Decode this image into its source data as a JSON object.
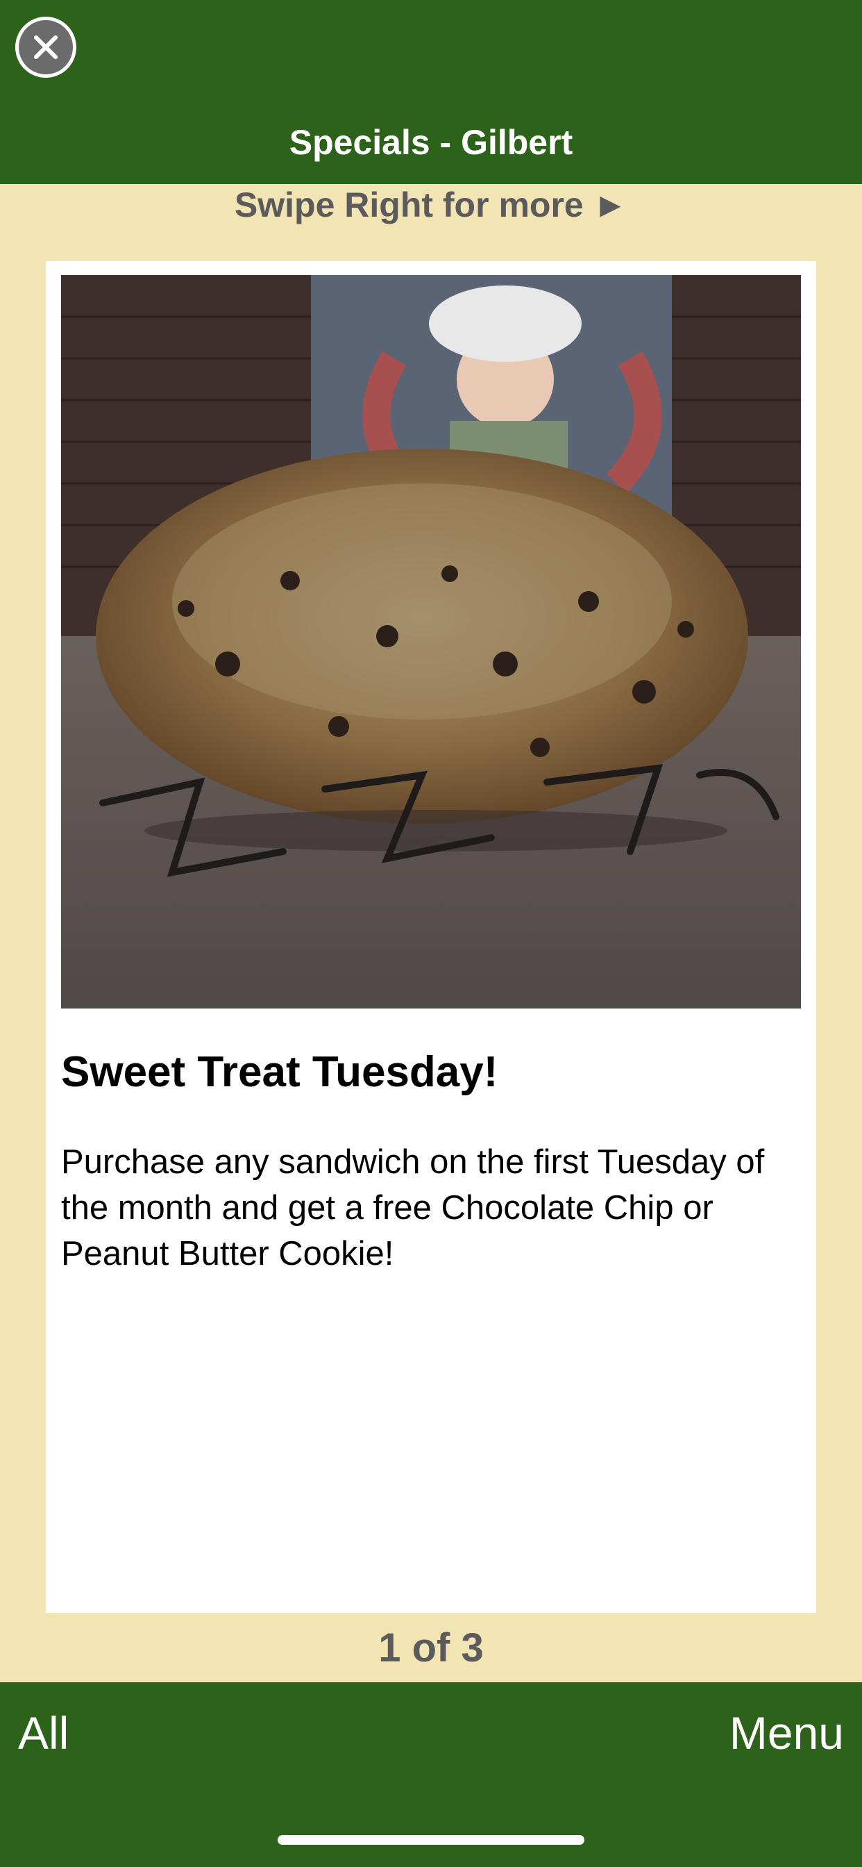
{
  "header": {
    "title": "Specials - Gilbert",
    "close_icon": "close-icon"
  },
  "swipe_hint": "Swipe Right for more ►",
  "card": {
    "image_icon": "cookie-photo",
    "title": "Sweet Treat Tuesday!",
    "description": "Purchase any sandwich on the first Tuesday of the month and get a free Chocolate Chip or Peanut Butter Cookie!"
  },
  "pager": "1 of 3",
  "footer": {
    "all_label": "All",
    "menu_label": "Menu"
  },
  "colors": {
    "brand_green": "#2c6219",
    "background_cream": "#f3e4b4",
    "card_white": "#ffffff",
    "muted_text": "#5b5b5b"
  }
}
